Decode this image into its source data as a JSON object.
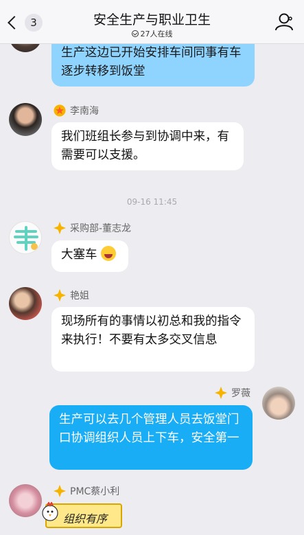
{
  "header": {
    "back_count": "3",
    "title": "安全生产与职业卫生",
    "online": "27人在线"
  },
  "messages": [
    {
      "text": "生产这边已开始安排车间同事有车逐步转移到饭堂",
      "direction": "out-top"
    },
    {
      "sender": "李南海",
      "badge": "star",
      "text": "我们班组长参与到协调中来，有需要可以支援。",
      "direction": "in"
    },
    {
      "sender": "采购部-董志龙",
      "badge": "diamond",
      "text": "大塞车",
      "emoji": "laughing-tears",
      "direction": "in"
    },
    {
      "sender": "艳姐",
      "badge": "diamond",
      "text": "现场所有的事情以初总和我的指令来执行！不要有太多交叉信息",
      "direction": "in"
    },
    {
      "sender": "罗薇",
      "badge": "diamond",
      "text": "生产可以去几个管理人员去饭堂门口协调组织人员上下车，安全第一",
      "direction": "out"
    },
    {
      "sender": "PMC蔡小利",
      "badge": "diamond",
      "sticker_text": "组织有序",
      "direction": "in"
    }
  ],
  "timestamp": "09-16 11:45",
  "colors": {
    "outgoing_bubble": "#19adf5",
    "incoming_bubble": "#ffffff",
    "background": "#ececf1",
    "badge_gold": "#f6b400"
  }
}
